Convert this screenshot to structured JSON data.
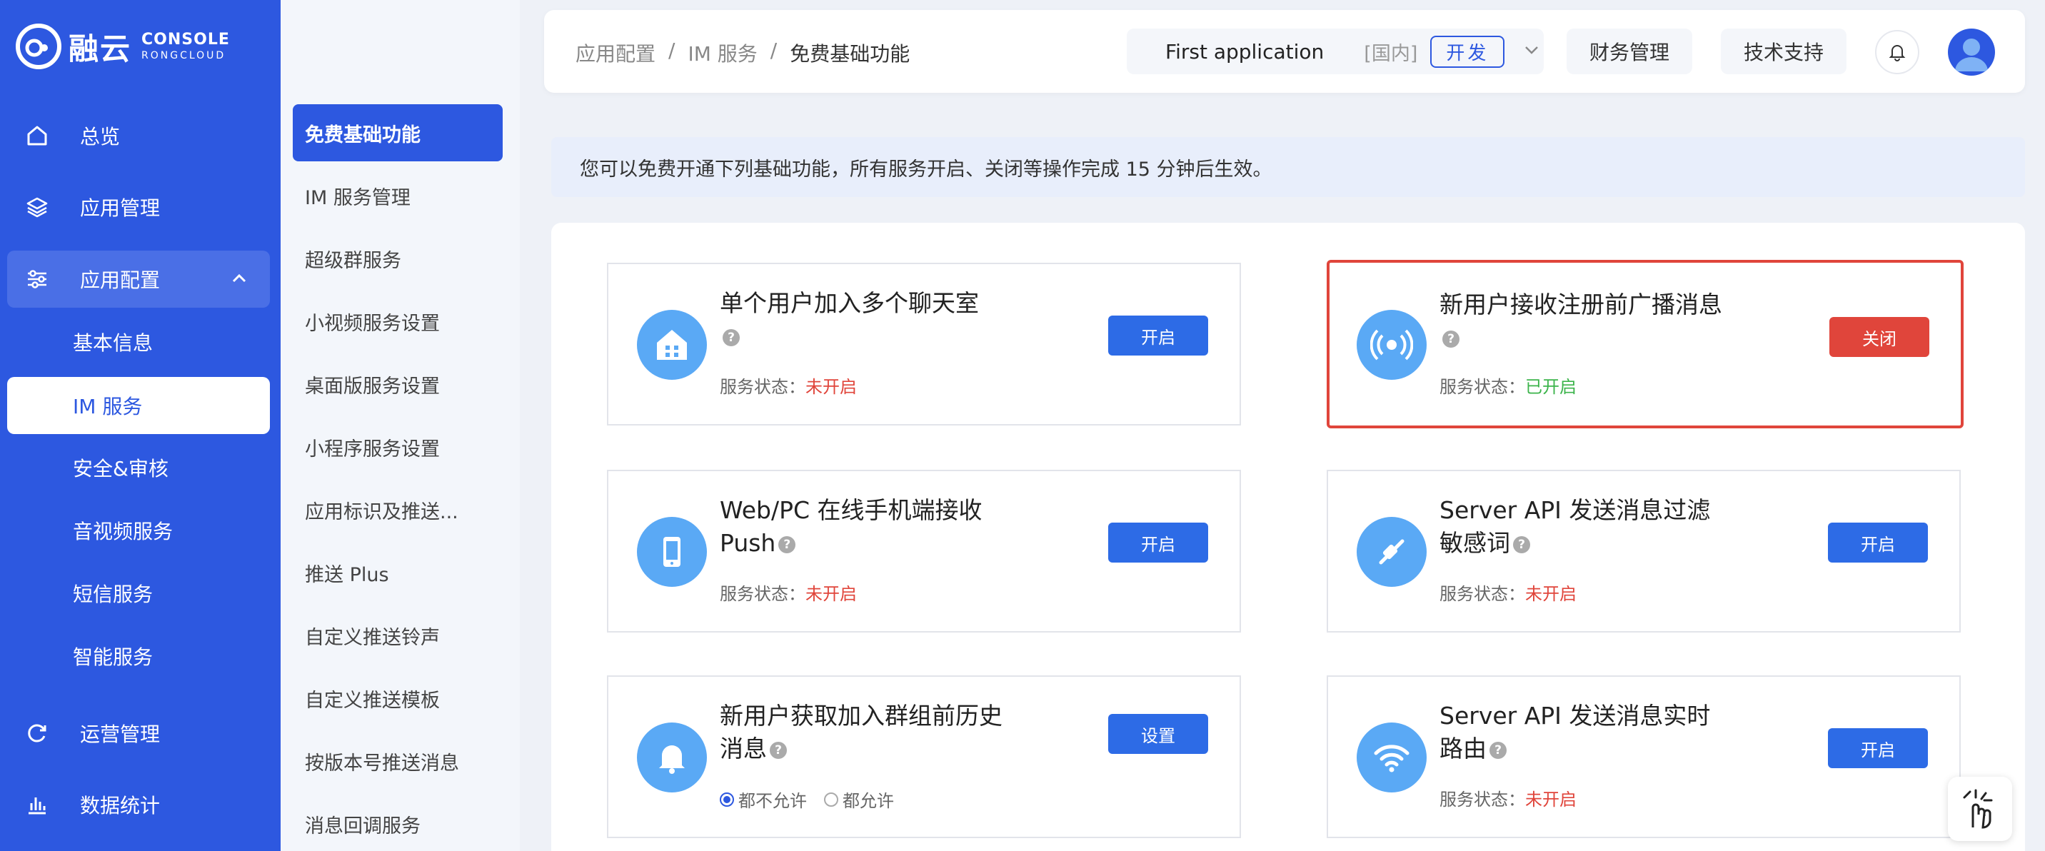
{
  "brand": {
    "logo_text": "融云",
    "console_label": "CONSOLE",
    "sub_label": "RONGCLOUD",
    "color": "#2d58e0"
  },
  "nav": {
    "items": [
      {
        "label": "总览",
        "icon": "home-icon"
      },
      {
        "label": "应用管理",
        "icon": "layers-icon"
      },
      {
        "label": "应用配置",
        "icon": "sliders-icon"
      },
      {
        "label": "运营管理",
        "icon": "refresh-icon"
      },
      {
        "label": "数据统计",
        "icon": "bar-chart-icon"
      }
    ],
    "sub_items": [
      "基本信息",
      "IM 服务",
      "安全&审核",
      "音视频服务",
      "短信服务",
      "智能服务"
    ]
  },
  "subnav": {
    "items": [
      "免费基础功能",
      "IM 服务管理",
      "超级群服务",
      "小视频服务设置",
      "桌面版服务设置",
      "小程序服务设置",
      "应用标识及推送...",
      "推送 Plus",
      "自定义推送铃声",
      "自定义推送模板",
      "按版本号推送消息",
      "消息回调服务"
    ]
  },
  "header": {
    "breadcrumb": [
      "应用配置",
      "/",
      "IM 服务",
      "/",
      "免费基础功能"
    ],
    "app_name": "First application",
    "region": "[国内]",
    "env": "开发",
    "finance": "财务管理",
    "support": "技术支持"
  },
  "notice": "您可以免费开通下列基础功能，所有服务开启、关闭等操作完成 15 分钟后生效。",
  "status_label": "服务状态：",
  "cards": [
    {
      "title": "单个用户加入多个聊天室",
      "status": "未开启",
      "button": "开启",
      "icon": "chatroom-icon"
    },
    {
      "title": "新用户接收注册前广播消息",
      "status": "已开启",
      "button": "关闭",
      "icon": "broadcast-icon"
    },
    {
      "title": "Web/PC 在线手机端接收 Push",
      "status": "未开启",
      "button": "开启",
      "icon": "phone-icon"
    },
    {
      "title": "Server API 发送消息过滤敏感词",
      "status": "未开启",
      "button": "开启",
      "icon": "plug-icon"
    },
    {
      "title": "新用户获取加入群组前历史消息",
      "button": "设置",
      "icon": "bell-icon",
      "options": [
        "都不允许",
        "都允许"
      ],
      "selected": "都不允许"
    },
    {
      "title": "Server API 发送消息实时路由",
      "status": "未开启",
      "button": "开启",
      "icon": "wifi-icon"
    }
  ],
  "colors": {
    "danger": "#e0453b",
    "success": "#3cb44b",
    "primary": "#2d6be6"
  }
}
